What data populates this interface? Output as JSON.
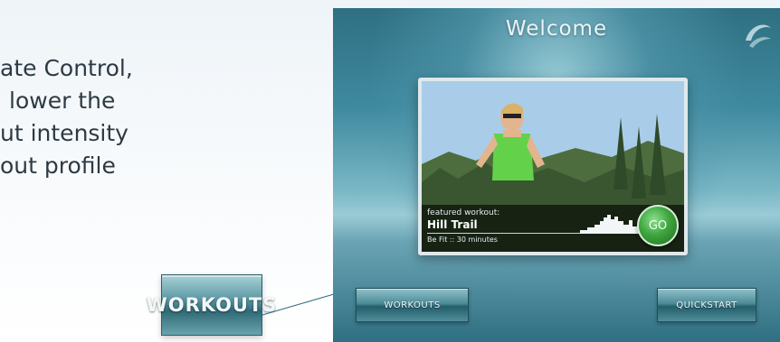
{
  "body_text": {
    "lines": [
      "ate Control,",
      "lower the",
      "ut intensity",
      "out profile"
    ]
  },
  "callout": {
    "button_label": "WORKOUTS"
  },
  "screen": {
    "title": "Welcome",
    "featured": {
      "label": "featured workout:",
      "name": "Hill Trail",
      "subtitle": "Be Fit :: 30 minutes",
      "go_label": "GO"
    },
    "buttons": {
      "workouts": "WORKOUTS",
      "quickstart": "QUICKSTART"
    }
  },
  "colors": {
    "screen_bg": "#3f8aa0",
    "button_teal": "#4d8c98",
    "go_green": "#3fa53f"
  },
  "icons": [
    "swoosh-logo-icon",
    "elevation-profile-icon"
  ]
}
